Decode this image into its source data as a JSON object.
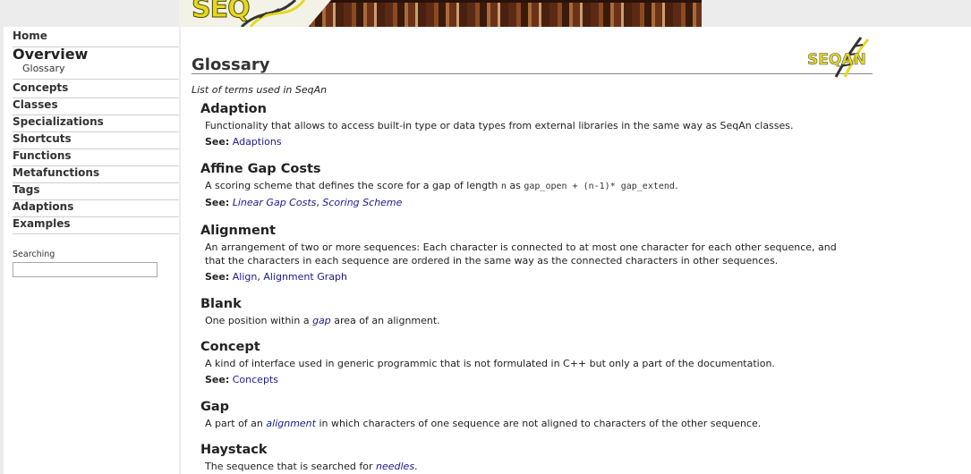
{
  "banner": {
    "logo_text": "SEQ"
  },
  "sidebar": {
    "home": "Home",
    "overview": "Overview",
    "glossary": "Glossary",
    "items": [
      "Concepts",
      "Classes",
      "Specializations",
      "Shortcuts",
      "Functions",
      "Metafunctions",
      "Tags",
      "Adaptions",
      "Examples"
    ],
    "search_label": "Searching",
    "search_value": ""
  },
  "page": {
    "title": "Glossary",
    "logo_text": "SEQAN",
    "intro": "List of terms used in SeqAn",
    "see_label": "See:"
  },
  "entries": {
    "adaption": {
      "term": "Adaption",
      "def": "Functionality that allows to access built-in type or data types from external libraries in the same way as SeqAn classes.",
      "see_link1": "Adaptions"
    },
    "affine": {
      "term": "Affine Gap Costs",
      "def_a": "A scoring scheme that defines the score for a gap of length ",
      "def_n": "n",
      "def_b": " as ",
      "def_code": "gap_open + (n-1)* gap_extend",
      "def_c": ".",
      "see_link1": "Linear Gap Costs",
      "see_sep": ", ",
      "see_link2": "Scoring Scheme"
    },
    "alignment": {
      "term": "Alignment",
      "def_line1": "An arrangement of two or more sequences: Each character is connected to at most one character for each other sequence, and",
      "def_line2": "that the characters in each sequence are ordered in the same way as the connected characters in other sequences.",
      "see_link1": "Align",
      "see_sep": ", ",
      "see_link2": "Alignment Graph"
    },
    "blank": {
      "term": "Blank",
      "def_a": "One position within a ",
      "def_link": "gap",
      "def_b": " area of an alignment."
    },
    "concept": {
      "term": "Concept",
      "def": "A kind of interface used in generic programmic that is not formulated in C++ but only a part of the documentation.",
      "see_link1": "Concepts"
    },
    "gap": {
      "term": "Gap",
      "def_a": "A part of an ",
      "def_link": "alignment",
      "def_b": " in which characters of one sequence are not aligned to characters of the other sequence."
    },
    "haystack": {
      "term": "Haystack",
      "def_a": "The sequence that is searched for ",
      "def_link": "needles",
      "def_b": "."
    }
  },
  "colors": {
    "link": "#1a1a8c",
    "logo_yellow": "#e6d820",
    "background": "#ececec"
  }
}
